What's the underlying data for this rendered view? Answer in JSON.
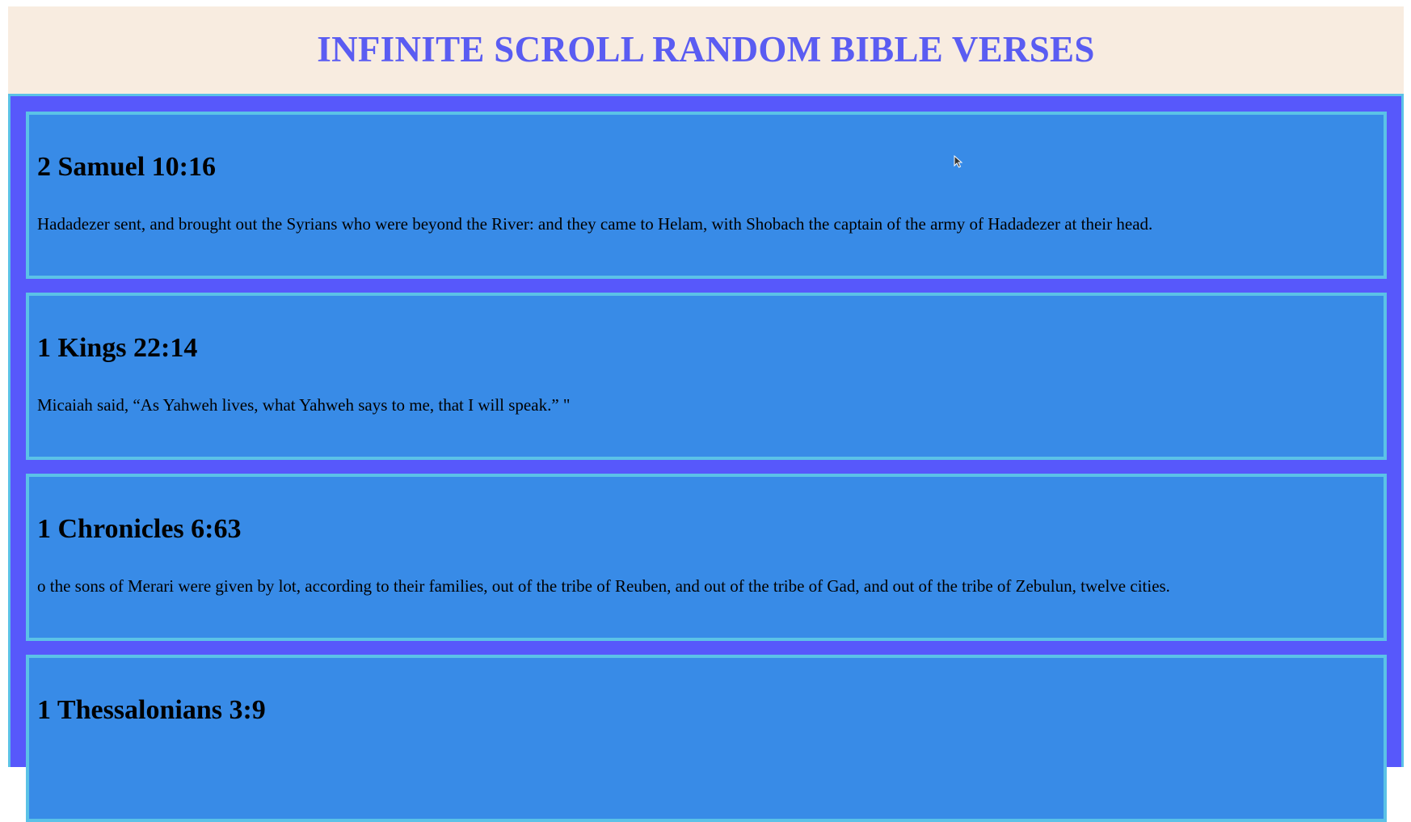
{
  "header": {
    "title": "INFINITE SCROLL RANDOM BIBLE VERSES"
  },
  "verses": [
    {
      "reference": "2 Samuel 10:16",
      "text": "Hadadezer sent, and brought out the Syrians who were beyond the River: and they came to Helam, with Shobach the captain of the army of Hadadezer at their head."
    },
    {
      "reference": "1 Kings 22:14",
      "text": "Micaiah said, “As Yahweh lives, what Yahweh says to me, that I will speak.” \""
    },
    {
      "reference": "1 Chronicles 6:63",
      "text": "o the sons of Merari were given by lot, according to their families, out of the tribe of Reuben, and out of the tribe of Gad, and out of the tribe of Zebulun, twelve cities."
    },
    {
      "reference": "1 Thessalonians 3:9",
      "text": ""
    }
  ],
  "colors": {
    "header_bg": "#f8ece0",
    "title": "#5a5cf2",
    "feed_bg": "#5758fb",
    "card_bg": "#388be7",
    "card_border": "#5bc2e7"
  },
  "icons": {
    "cursor": "mouse-pointer-icon"
  }
}
